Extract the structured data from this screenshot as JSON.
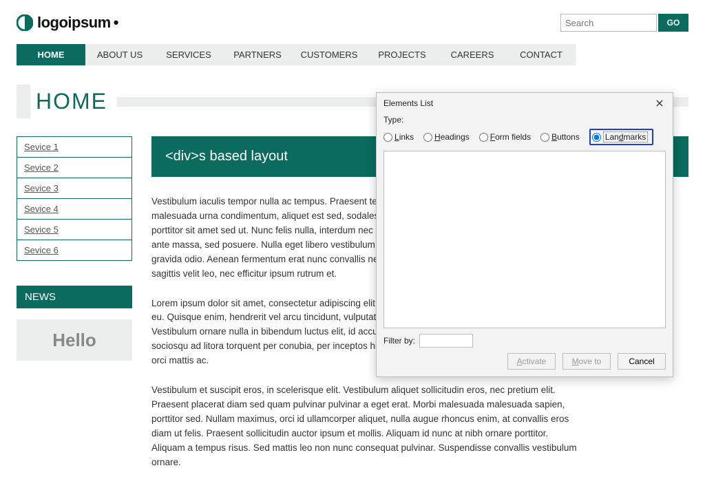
{
  "header": {
    "brand": "logoipsum",
    "search_placeholder": "Search",
    "go_label": "GO"
  },
  "nav": {
    "items": [
      "HOME",
      "ABOUT US",
      "SERVICES",
      "PARTNERS",
      "CUSTOMERS",
      "PROJECTS",
      "CAREERS",
      "CONTACT"
    ],
    "active_index": 0
  },
  "page_title": "HOME",
  "sidebar": {
    "services": [
      "Sevice 1",
      "Sevice 2",
      "Sevice 3",
      "Sevice 4",
      "Sevice 5",
      "Sevice 6"
    ],
    "news_heading": "NEWS",
    "news_hello": "Hello"
  },
  "content": {
    "banner": "<div>s based layout",
    "p1": "Vestibulum iaculis tempor nulla ac tempus. Praesent tempor leo nec ipsum dignissim fermentum. Sed malesuada urna condimentum, aliquet est sed, sodales justo. Pellentesque eu erat vitae lorem dictum porttitor sit amet sed ut. Nunc felis nulla, interdum nec odio porttitor, tristique tempus velit. In fermentum ante massa, sed posuere. Nulla eget libero vestibulum, malesuada leo nec, pretium sapien. Sed nec gravida odio. Aenean fermentum erat nunc convallis neque, ac suscipit libero risus a tortor. Proin sagittis velit leo, nec efficitur ipsum rutrum et.",
    "p2": "Lorem ipsum dolor sit amet, consectetur adipiscing elit. Pellentesque eu velit justo. Curabitur ac mauris eu. Quisque enim, hendrerit vel arcu tincidunt, vulputate fringilla justo. Sed eu congue massa. Vestibulum ornare nulla in bibendum luctus elit, id accumsan ex mattis sit amet. Class aptent taciti sociosqu ad litora torquent per conubia, per inceptos himenaeos. Nam porta enim tellus, ac posuere orci mattis ac.",
    "p3": "Vestibulum et suscipit eros, in scelerisque elit. Vestibulum aliquet sollicitudin eros, nec pretium elit. Praesent placerat diam sed quam pulvinar pulvinar a eget erat. Morbi malesuada malesuada sapien, porttitor sed. Nullam maximus, orci id ullamcorper aliquet, nulla augue rhoncus enim, at convallis eros diam ut felis. Praesent sollicitudin auctor ipsum et mollis. Aliquam id nunc at nibh ornare porttitor. Aliquam a tempus risus. Sed mattis leo non nunc consequat pulvinar. Suspendisse convallis vestibulum ornare."
  },
  "dialog": {
    "title": "Elements List",
    "type_label": "Type:",
    "radios": {
      "links": "Links",
      "headings": "Headings",
      "form_fields": "Form fields",
      "buttons": "Buttons",
      "landmarks": "Landmarks"
    },
    "filter_label": "Filter by:",
    "buttons": {
      "activate": "Activate",
      "moveto": "Move to",
      "cancel": "Cancel"
    }
  }
}
